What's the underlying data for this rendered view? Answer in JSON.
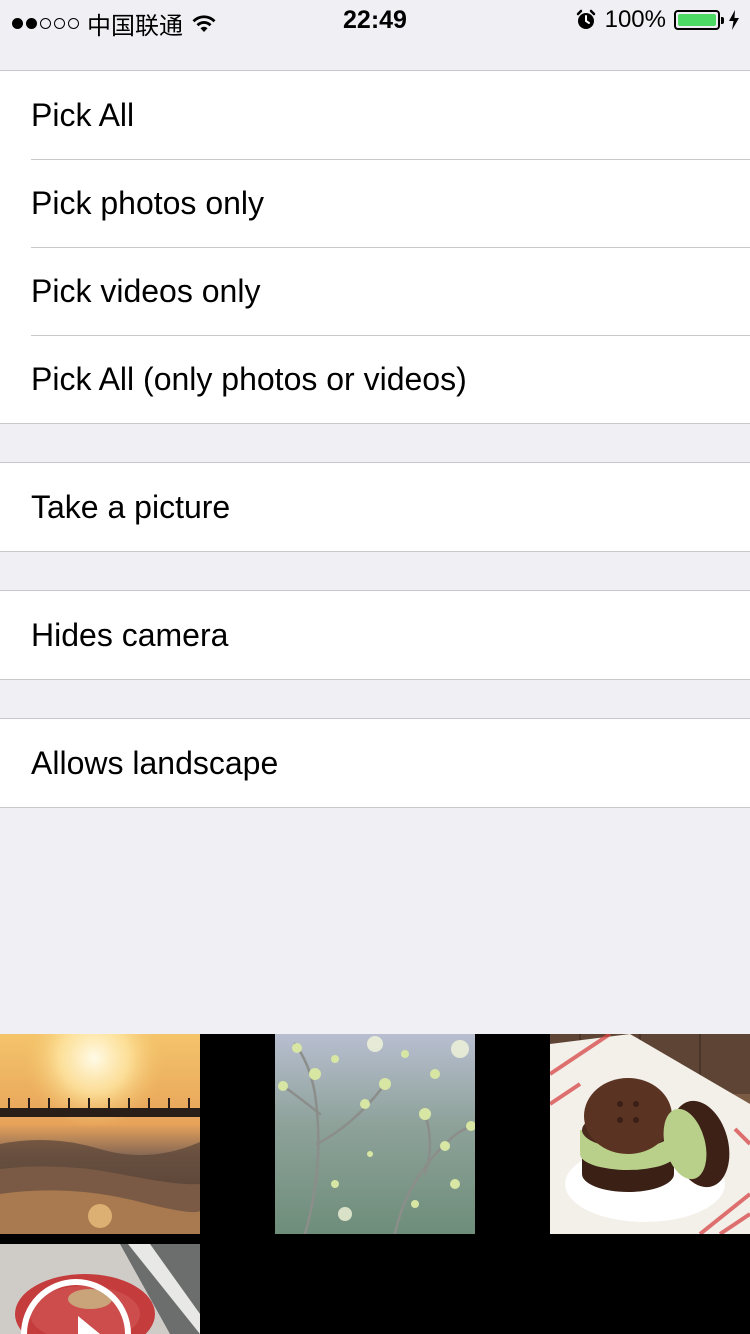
{
  "status_bar": {
    "carrier": "中国联通",
    "time": "22:49",
    "battery": "100%",
    "signal_strength": 2,
    "signal_max": 5,
    "battery_color": "#4cd964"
  },
  "sections": [
    {
      "rows": [
        "Pick All",
        "Pick photos only",
        "Pick videos only",
        "Pick All (only photos or videos)"
      ]
    },
    {
      "rows": [
        "Take a picture"
      ]
    },
    {
      "rows": [
        "Hides camera"
      ]
    },
    {
      "rows": [
        "Allows landscape"
      ]
    }
  ],
  "photos": [
    {
      "icon": "sunset-pier-photo"
    },
    {
      "icon": "blossom-branch-photo"
    },
    {
      "icon": "sandwich-cookie-photo"
    },
    {
      "icon": "video-dog-thumbnail"
    }
  ],
  "colors": {
    "background": "#efeff4",
    "separator": "#c8c7cc"
  }
}
